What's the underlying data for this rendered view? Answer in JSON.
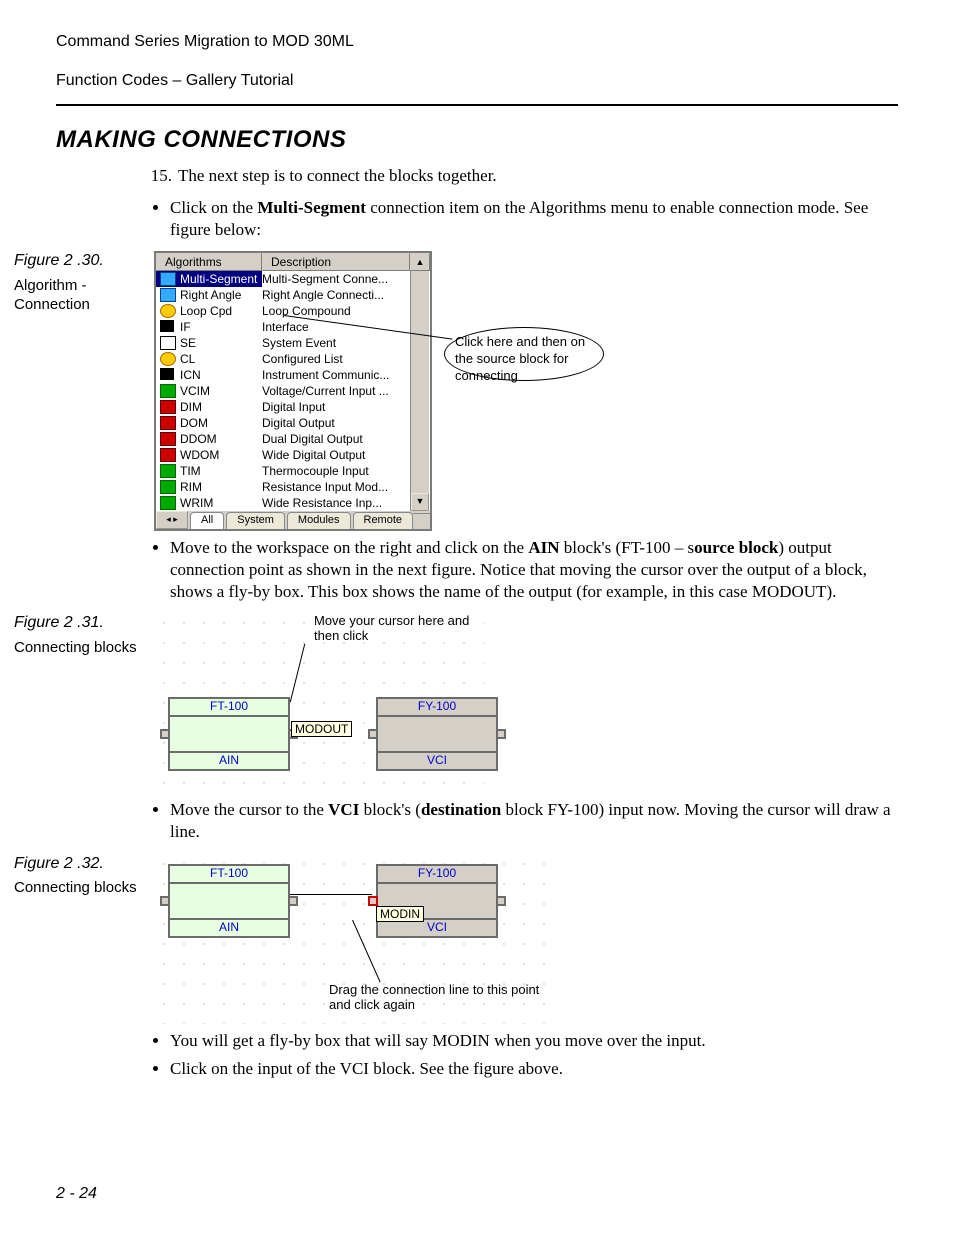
{
  "header": {
    "line1": "Command Series Migration to MOD 30ML",
    "line2": "Function Codes – Gallery Tutorial"
  },
  "section_title": "MAKING CONNECTIONS",
  "step_number": "15.",
  "step_text": "The next step is to connect the blocks together.",
  "bullet1_pre": "Click on the ",
  "bullet1_bold": "Multi-Segment",
  "bullet1_post": " connection item on the Algorithms menu to enable connection mode. See figure below:",
  "fig30": {
    "num": "Figure 2 .30.",
    "txt": "Algorithm - Connection",
    "headers": {
      "alg": "Algorithms",
      "desc": "Description"
    },
    "rows": [
      {
        "alg": "Multi-Segment",
        "desc": "Multi-Segment Conne...",
        "selected": true
      },
      {
        "alg": "Right Angle",
        "desc": "Right Angle Connecti..."
      },
      {
        "alg": "Loop Cpd",
        "desc": "Loop Compound"
      },
      {
        "alg": "IF",
        "desc": "Interface"
      },
      {
        "alg": "SE",
        "desc": "System Event"
      },
      {
        "alg": "CL",
        "desc": "Configured List"
      },
      {
        "alg": "ICN",
        "desc": "Instrument Communic..."
      },
      {
        "alg": "VCIM",
        "desc": "Voltage/Current Input ..."
      },
      {
        "alg": "DIM",
        "desc": "Digital Input"
      },
      {
        "alg": "DOM",
        "desc": "Digital Output"
      },
      {
        "alg": "DDOM",
        "desc": "Dual Digital Output"
      },
      {
        "alg": "WDOM",
        "desc": "Wide Digital Output"
      },
      {
        "alg": "TIM",
        "desc": "Thermocouple Input"
      },
      {
        "alg": "RIM",
        "desc": "Resistance Input Mod..."
      },
      {
        "alg": "WRIM",
        "desc": "Wide Resistance Inp..."
      }
    ],
    "tabs": [
      "All",
      "System",
      "Modules",
      "Remote"
    ],
    "callout": "Click here and then on the source block for connecting"
  },
  "bullet2": {
    "p1": "Move to the workspace on the right and click on the ",
    "b1": "AIN",
    "p2": " block's (FT-100 – s",
    "b2": "ource block",
    "p3": ") output connection point as shown in the next figure. Notice that moving the cursor over the output of a block, shows a fly-by box. This box shows the name of the output (for example, in this case MODOUT)."
  },
  "fig31": {
    "num": "Figure 2 .31.",
    "txt": "Connecting blocks",
    "annot": "Move your cursor here and then click",
    "block1_title": "FT-100",
    "block1_footer": "AIN",
    "block2_title": "FY-100",
    "block2_footer": "VCI",
    "flybox": "MODOUT"
  },
  "bullet3": {
    "p1": "Move the cursor to the ",
    "b1": "VCI",
    "p2": " block's (",
    "b2": "destination",
    "p3": " block FY-100) input now. Moving the cursor will draw a line."
  },
  "fig32": {
    "num": "Figure 2 .32.",
    "txt": "Connecting blocks",
    "block1_title": "FT-100",
    "block1_footer": "AIN",
    "block2_title": "FY-100",
    "block2_footer": "VCI",
    "flybox": "MODIN",
    "annot": "Drag the connection line to this point and click again"
  },
  "bullet4": "You will get a fly-by box that will say MODIN when you move over the input.",
  "bullet5": "Click on the input of the VCI block. See the figure above.",
  "page_number": "2 - 24"
}
